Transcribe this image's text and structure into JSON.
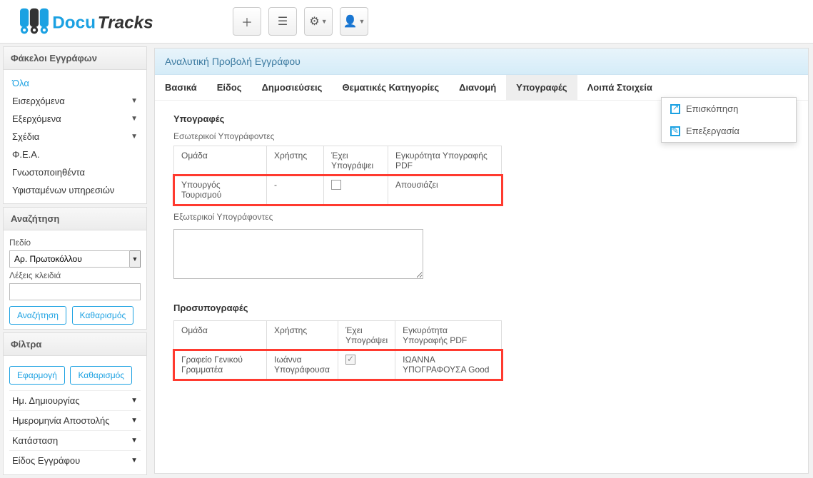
{
  "toolbar": {
    "add_title": "Add",
    "list_title": "List",
    "settings_title": "Settings",
    "user_title": "User"
  },
  "sidebar": {
    "folders": {
      "header": "Φάκελοι Εγγράφων",
      "items": [
        {
          "label": "Όλα",
          "active": true,
          "caret": false
        },
        {
          "label": "Εισερχόμενα",
          "active": false,
          "caret": true
        },
        {
          "label": "Εξερχόμενα",
          "active": false,
          "caret": true
        },
        {
          "label": "Σχέδια",
          "active": false,
          "caret": true
        },
        {
          "label": "Φ.Ε.Α.",
          "active": false,
          "caret": false
        },
        {
          "label": "Γνωστοποιηθέντα",
          "active": false,
          "caret": false
        },
        {
          "label": "Υφισταμένων υπηρεσιών",
          "active": false,
          "caret": false
        }
      ]
    },
    "search": {
      "header": "Αναζήτηση",
      "field_label": "Πεδίο",
      "field_value": "Αρ. Πρωτοκόλλου",
      "keywords_label": "Λέξεις κλειδιά",
      "keywords_value": "",
      "search_btn": "Αναζήτηση",
      "clear_btn": "Καθαρισμός"
    },
    "filters": {
      "header": "Φίλτρα",
      "apply_btn": "Εφαρμογή",
      "clear_btn": "Καθαρισμός",
      "rows": [
        {
          "label": "Ημ. Δημιουργίας"
        },
        {
          "label": "Ημερομηνία Αποστολής"
        },
        {
          "label": "Κατάσταση"
        },
        {
          "label": "Είδος Εγγράφου"
        }
      ]
    }
  },
  "main": {
    "title": "Αναλυτική Προβολή Εγγράφου",
    "tabs": [
      {
        "label": "Βασικά"
      },
      {
        "label": "Είδος"
      },
      {
        "label": "Δημοσιεύσεις"
      },
      {
        "label": "Θεματικές Κατηγορίες"
      },
      {
        "label": "Διανομή"
      },
      {
        "label": "Υπογραφές",
        "active": true
      },
      {
        "label": "Λοιπά Στοιχεία"
      }
    ],
    "signatures": {
      "heading": "Υπογραφές",
      "internal_heading": "Εσωτερικοί Υπογράφοντες",
      "columns": {
        "group": "Ομάδα",
        "user": "Χρήστης",
        "signed": "Έχει Υπογράψει",
        "validity": "Εγκυρότητα Υπογραφής PDF"
      },
      "internal_rows": [
        {
          "group": "Υπουργός Τουρισμού",
          "user": "-",
          "signed": false,
          "validity": "Απουσιάζει"
        }
      ],
      "external_heading": "Εξωτερικοί Υπογράφοντες",
      "external_value": "",
      "presign_heading": "Προσυπογραφές",
      "presign_rows": [
        {
          "group": "Γραφείο Γενικού Γραμματέα",
          "user": "Ιωάννα Υπογράφουσα",
          "signed": true,
          "validity": "ΙΩΑΝΝΑ ΥΠΟΓΡΑΦΟΥΣΑ Good"
        }
      ]
    },
    "action_menu": {
      "preview": "Επισκόπηση",
      "edit": "Επεξεργασία"
    }
  }
}
